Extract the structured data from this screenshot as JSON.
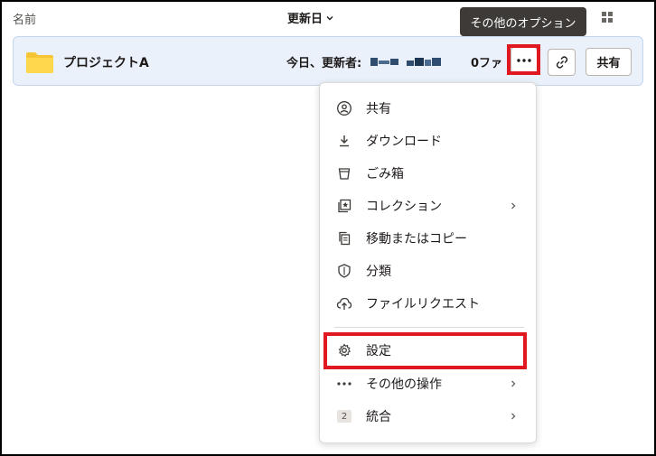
{
  "header": {
    "name_label": "名前",
    "modified_label": "更新日"
  },
  "tooltip": {
    "text": "その他のオプション"
  },
  "file_row": {
    "name": "プロジェクトA",
    "modified": "今日、更新者:",
    "count": "0ファ",
    "share_label": "共有"
  },
  "menu": {
    "items": [
      {
        "label": "共有",
        "icon": "share-person-icon"
      },
      {
        "label": "ダウンロード",
        "icon": "download-icon"
      },
      {
        "label": "ごみ箱",
        "icon": "trash-icon"
      },
      {
        "label": "コレクション",
        "icon": "collection-star-icon",
        "submenu": true
      },
      {
        "label": "移動またはコピー",
        "icon": "copy-icon"
      },
      {
        "label": "分類",
        "icon": "shield-icon"
      },
      {
        "label": "ファイルリクエスト",
        "icon": "cloud-upload-icon"
      },
      {
        "label": "設定",
        "icon": "gear-icon"
      },
      {
        "label": "その他の操作",
        "icon": "more-dots-icon",
        "submenu": true
      },
      {
        "label": "統合",
        "icon": "integration-badge-icon",
        "badge": "2",
        "submenu": true
      }
    ]
  },
  "colors": {
    "row_bg": "#eaf1fb",
    "highlight": "#e0181f",
    "tooltip_bg": "#3d3a37",
    "folder": "#ffd84d"
  }
}
